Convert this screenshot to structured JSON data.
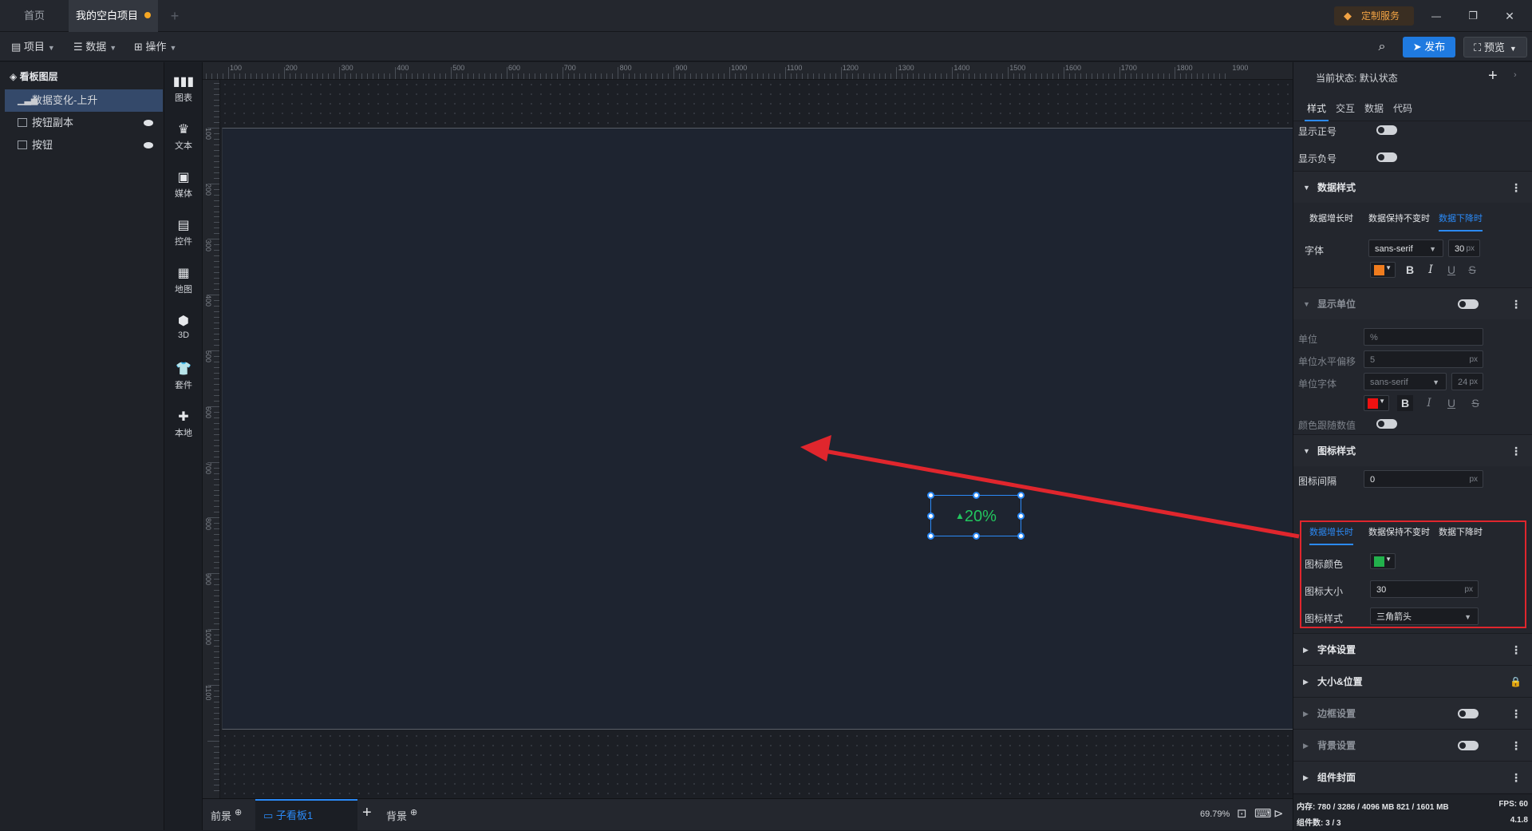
{
  "tabs": [
    {
      "label": "首页"
    },
    {
      "label": "我的空白项目"
    }
  ],
  "titlebar": {
    "custom_service": "定制服务"
  },
  "toolbar": {
    "menus": [
      {
        "label": "项目"
      },
      {
        "label": "数据"
      },
      {
        "label": "操作"
      }
    ],
    "publish": "发布",
    "preview": "预览"
  },
  "layers": {
    "title": "看板图层",
    "items": [
      {
        "label": "数据变化-上升"
      },
      {
        "label": "按钮副本"
      },
      {
        "label": "按钮"
      }
    ]
  },
  "sidebar_tools": [
    {
      "label": "图表",
      "icon": "chart-icon"
    },
    {
      "label": "文本",
      "icon": "text-icon"
    },
    {
      "label": "媒体",
      "icon": "media-icon"
    },
    {
      "label": "控件",
      "icon": "control-icon"
    },
    {
      "label": "地图",
      "icon": "map-icon"
    },
    {
      "label": "3D",
      "icon": "cube-icon"
    },
    {
      "label": "套件",
      "icon": "suite-icon"
    },
    {
      "label": "本地",
      "icon": "puzzle-icon"
    }
  ],
  "ruler": {
    "h_labels": [
      "100",
      "200",
      "300",
      "400",
      "500",
      "600",
      "700",
      "800",
      "900",
      "1000",
      "1100",
      "1200",
      "1300",
      "1400",
      "1500",
      "1600",
      "1700",
      "1800",
      "1900"
    ],
    "v_labels": [
      "100",
      "200",
      "300",
      "400",
      "500",
      "600",
      "700",
      "800",
      "900",
      "1000",
      "1100"
    ]
  },
  "widget": {
    "value_text": "20%",
    "color": "#22c55e"
  },
  "bottom": {
    "front": "前景",
    "subboard": "子看板1",
    "background": "背景",
    "zoom": "69.79%"
  },
  "rpanel": {
    "state_label": "当前状态:",
    "state_value": "默认状态",
    "tabs": [
      "样式",
      "交互",
      "数据",
      "代码"
    ],
    "show_plus": "显示正号",
    "show_minus": "显示负号",
    "data_style": "数据样式",
    "conditions": [
      "数据增长时",
      "数据保持不变时",
      "数据下降时"
    ],
    "font_label": "字体",
    "font_family": "sans-serif",
    "font_size": "30",
    "px": "px",
    "font_color": "#f07c1e",
    "show_unit": "显示单位",
    "unit_label": "单位",
    "unit_value": "%",
    "unit_offset_label": "单位水平偏移",
    "unit_offset_value": "5",
    "unit_font_label": "单位字体",
    "unit_font_family": "sans-serif",
    "unit_font_size": "24",
    "unit_color": "#ee1111",
    "color_follow": "颜色跟随数值",
    "icon_style_section": "图标样式",
    "icon_gap_label": "图标间隔",
    "icon_gap_value": "0",
    "icon_color_label": "图标颜色",
    "icon_color": "#22b14c",
    "icon_size_label": "图标大小",
    "icon_size_value": "30",
    "icon_style_label": "图标样式",
    "icon_style_value": "三角箭头",
    "sections_bottom": [
      "字体设置",
      "大小&位置",
      "边框设置",
      "背景设置",
      "组件封面"
    ]
  },
  "status": {
    "mem": "内存: 780 / 3286 / 4096 MB  821 / 1601 MB",
    "fps": "FPS: 60",
    "count": "组件数: 3 / 3",
    "version": "4.1.8"
  }
}
